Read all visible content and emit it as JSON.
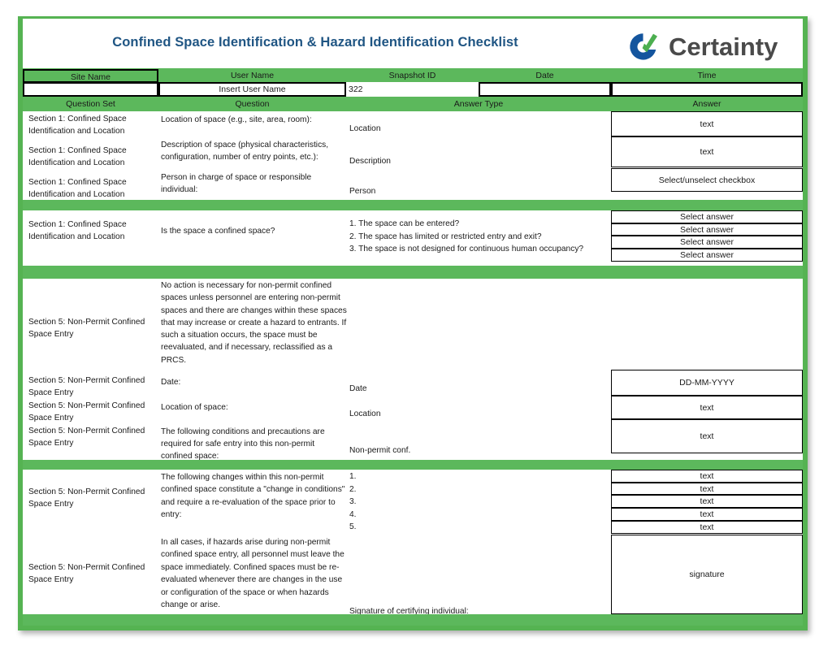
{
  "document": {
    "title": "Confined Space Identification & Hazard Identification Checklist",
    "brand_name": "Certainty",
    "colors": {
      "title_blue": "#1F5583",
      "band_green": "#5CB85C",
      "logo_blue": "#14559E",
      "logo_green": "#4CAF50",
      "logo_text": "#4A4A4A"
    }
  },
  "meta_header": {
    "columns": [
      {
        "label": "Site Name"
      },
      {
        "label": "User Name"
      },
      {
        "label": "Snapshot ID"
      },
      {
        "label": "Date"
      },
      {
        "label": "Time"
      }
    ],
    "values": {
      "site_name": "",
      "user_name": "Insert User Name",
      "snapshot_id": "322",
      "date": "",
      "time": ""
    }
  },
  "table_header": {
    "question_set": "Question Set",
    "question": "Question",
    "answer_type": "Answer Type",
    "answer": "Answer"
  },
  "rows": [
    {
      "question_set": "Section 1: Confined Space Identification and Location",
      "question": "Location of space (e.g., site, area, room):",
      "answer_type": "Location",
      "answer": "text"
    },
    {
      "question_set": "Section 1: Confined Space Identification and Location",
      "question": "Description of space (physical characteristics, configuration, number of entry points, etc.):",
      "answer_type": "Description",
      "answer": "text"
    },
    {
      "question_set": "Section 1: Confined Space Identification and Location",
      "question": "Person in charge of space or responsible individual:",
      "answer_type": "Person",
      "answer": "Select/unselect checkbox"
    }
  ],
  "confined_space_block": {
    "question_set": "Section 1: Confined Space Identification and Location",
    "question": "Is the space a confined space?",
    "answer_type_items": [
      "1. The space can be entered?",
      "2. The space has limited or restricted entry and exit?",
      "3. The space is not designed for continuous human occupancy?"
    ],
    "answers": [
      "Select answer",
      "Select answer",
      "Select answer",
      "Select answer"
    ]
  },
  "non_permit_block": {
    "question_set": "Section 5: Non-Permit Confined Space Entry",
    "narrative": "No action is necessary for non-permit confined spaces unless personnel are entering non-permit spaces and there are changes within these spaces that may increase or create a hazard to entrants. If such a situation occurs, the space must be reevaluated, and if necessary, reclassified as a PRCS.",
    "rows": [
      {
        "question_set": "Section 5: Non-Permit Confined Space Entry",
        "question": "Date:",
        "answer_type": "Date",
        "answer": "DD-MM-YYYY"
      },
      {
        "question_set": "Section 5: Non-Permit Confined Space Entry",
        "question": "Location of space:",
        "answer_type": "Location",
        "answer": "text"
      },
      {
        "question_set": "Section 5: Non-Permit Confined Space Entry",
        "question": "The following conditions and precautions are required for safe entry into this non-permit confined space:",
        "answer_type": "Non-permit conf.",
        "answer": "text"
      }
    ]
  },
  "changes_block": {
    "question_set": "Section 5: Non-Permit Confined Space Entry",
    "question": "The following changes within this non-permit confined space constitute a \"change in conditions\" and require a re-evaluation of the space prior to entry:",
    "answer_type_items": [
      "1.",
      "2.",
      "3.",
      "4.",
      "5."
    ],
    "answers": [
      "text",
      "text",
      "text",
      "text",
      "text"
    ]
  },
  "signature_block": {
    "question_set": "Section 5: Non-Permit Confined Space Entry",
    "question": "In all cases, if hazards arise during non-permit confined space entry, all personnel must leave the space immediately. Confined spaces must be re-evaluated whenever there are changes in the use or configuration of the space or when hazards change or arise.",
    "answer_type": "Signature of certifying individual:",
    "answer": "signature"
  }
}
